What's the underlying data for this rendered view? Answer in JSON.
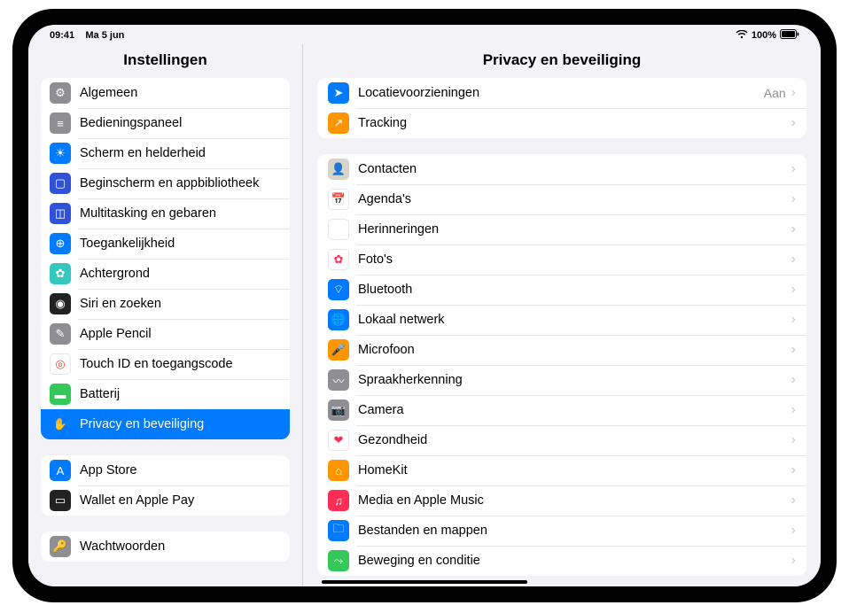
{
  "status": {
    "time": "09:41",
    "date": "Ma 5 jun",
    "battery": "100%"
  },
  "sidebar": {
    "title": "Instellingen",
    "groups": [
      {
        "items": [
          {
            "id": "general",
            "label": "Algemeen",
            "iconColor": "#8e8e93",
            "glyph": "⚙︎"
          },
          {
            "id": "control",
            "label": "Bedieningspaneel",
            "iconColor": "#8e8e93",
            "glyph": "≡"
          },
          {
            "id": "display",
            "label": "Scherm en helderheid",
            "iconColor": "#007aff",
            "glyph": "☀︎"
          },
          {
            "id": "home",
            "label": "Beginscherm en appbibliotheek",
            "iconColor": "#3052d9",
            "glyph": "▢"
          },
          {
            "id": "multitask",
            "label": "Multitasking en gebaren",
            "iconColor": "#3052d9",
            "glyph": "◫"
          },
          {
            "id": "accessibility",
            "label": "Toegankelijkheid",
            "iconColor": "#007aff",
            "glyph": "⊕"
          },
          {
            "id": "wallpaper",
            "label": "Achtergrond",
            "iconColor": "#34c7c0",
            "glyph": "✿"
          },
          {
            "id": "siri",
            "label": "Siri en zoeken",
            "iconColor": "#222",
            "glyph": "◉"
          },
          {
            "id": "pencil",
            "label": "Apple Pencil",
            "iconColor": "#8e8e93",
            "glyph": "✎"
          },
          {
            "id": "touchid",
            "label": "Touch ID en toegangscode",
            "iconColor": "#ffffff",
            "glyph": "◎",
            "glyphColor": "#ff3b30",
            "border": "#e5e5ea"
          },
          {
            "id": "battery",
            "label": "Batterij",
            "iconColor": "#34c759",
            "glyph": "▬"
          },
          {
            "id": "privacy",
            "label": "Privacy en beveiliging",
            "iconColor": "#007aff",
            "glyph": "✋",
            "selected": true
          }
        ]
      },
      {
        "items": [
          {
            "id": "appstore",
            "label": "App Store",
            "iconColor": "#007aff",
            "glyph": "A"
          },
          {
            "id": "wallet",
            "label": "Wallet en Apple Pay",
            "iconColor": "#222",
            "glyph": "▭"
          }
        ]
      },
      {
        "cut": true,
        "items": [
          {
            "id": "passwords",
            "label": "Wachtwoorden",
            "iconColor": "#8e8e93",
            "glyph": "🔑"
          }
        ]
      }
    ]
  },
  "main": {
    "title": "Privacy en beveiliging",
    "groups": [
      [
        {
          "id": "location",
          "label": "Locatievoorzieningen",
          "value": "Aan",
          "iconColor": "#007aff",
          "glyph": "➤"
        },
        {
          "id": "tracking",
          "label": "Tracking",
          "iconColor": "#ff9500",
          "glyph": "↗︎"
        }
      ],
      [
        {
          "id": "contacts",
          "label": "Contacten",
          "iconColor": "#d9d4c9",
          "glyph": "👤"
        },
        {
          "id": "agenda",
          "label": "Agenda's",
          "iconColor": "#ffffff",
          "glyph": "📅",
          "border": "#e5e5ea"
        },
        {
          "id": "reminders",
          "label": "Herinneringen",
          "iconColor": "#ffffff",
          "glyph": "☑︎",
          "border": "#e5e5ea"
        },
        {
          "id": "photos",
          "label": "Foto's",
          "iconColor": "#ffffff",
          "glyph": "✿",
          "glyphColor": "#ff2d55",
          "border": "#e5e5ea"
        },
        {
          "id": "bluetooth",
          "label": "Bluetooth",
          "iconColor": "#007aff",
          "glyph": "⌔"
        },
        {
          "id": "localnet",
          "label": "Lokaal netwerk",
          "iconColor": "#007aff",
          "glyph": "🌐"
        },
        {
          "id": "mic",
          "label": "Microfoon",
          "iconColor": "#ff9500",
          "glyph": "🎤"
        },
        {
          "id": "speech",
          "label": "Spraakherkenning",
          "iconColor": "#8e8e93",
          "glyph": "〰︎"
        },
        {
          "id": "camera",
          "label": "Camera",
          "iconColor": "#8e8e93",
          "glyph": "📷"
        },
        {
          "id": "health",
          "label": "Gezondheid",
          "iconColor": "#ffffff",
          "glyph": "❤︎",
          "glyphColor": "#ff2d55",
          "border": "#e5e5ea"
        },
        {
          "id": "homekit",
          "label": "HomeKit",
          "iconColor": "#ff9500",
          "glyph": "⌂"
        },
        {
          "id": "media",
          "label": "Media en Apple Music",
          "iconColor": "#ff2d55",
          "glyph": "♫"
        },
        {
          "id": "files",
          "label": "Bestanden en mappen",
          "iconColor": "#007aff",
          "glyph": "🗀"
        },
        {
          "id": "motion",
          "label": "Beweging en conditie",
          "iconColor": "#34c759",
          "glyph": "⤳"
        }
      ]
    ]
  }
}
